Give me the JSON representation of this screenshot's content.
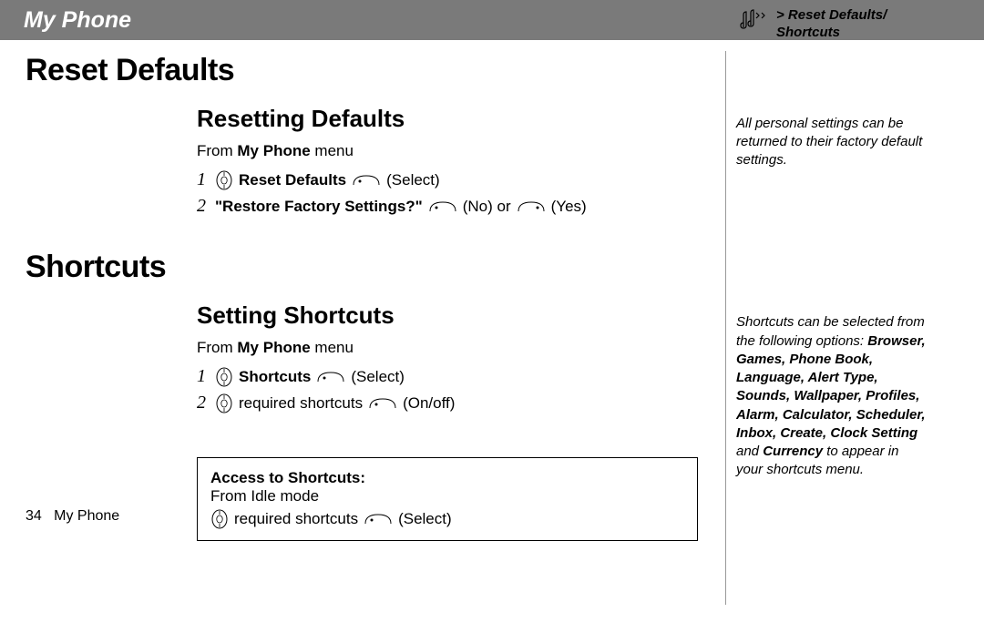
{
  "header": {
    "title": "My Phone"
  },
  "corner": {
    "breadcrumb_line1": "> Reset Defaults/",
    "breadcrumb_line2": "Shortcuts"
  },
  "section1": {
    "h1": "Reset Defaults",
    "h2": "Resetting Defaults",
    "from_prefix": "From ",
    "from_bold": "My Phone",
    "from_suffix": " menu",
    "step1_num": "1",
    "step1_bold": "Reset Defaults",
    "step1_action": "(Select)",
    "step2_num": "2",
    "step2_bold": "\"Restore Factory Settings?\"",
    "step2_mid1": "(No) or",
    "step2_mid2": "(Yes)"
  },
  "section2": {
    "h1": "Shortcuts",
    "h2": "Setting Shortcuts",
    "from_prefix": "From ",
    "from_bold": "My Phone",
    "from_suffix": " menu",
    "step1_num": "1",
    "step1_bold": "Shortcuts",
    "step1_action": "(Select)",
    "step2_num": "2",
    "step2_text": "required shortcuts",
    "step2_action": "(On/off)"
  },
  "box": {
    "title": "Access to Shortcuts:",
    "line1": "From Idle mode",
    "line2_text": "required shortcuts",
    "line2_action": "(Select)"
  },
  "notes": {
    "n1": "All personal settings can be returned to their factory default settings.",
    "n2_pre": "Shortcuts can be selected from the following options: ",
    "n2_bold": "Browser, Games, Phone Book, Language, Alert Type, Sounds, Wallpaper, Profiles, Alarm, Calculator, Scheduler, Inbox, Create, Clock Setting",
    "n2_mid": " and ",
    "n2_bold2": "Currency",
    "n2_post": " to appear in your shortcuts menu."
  },
  "footer": {
    "page": "34",
    "label": "My Phone"
  }
}
